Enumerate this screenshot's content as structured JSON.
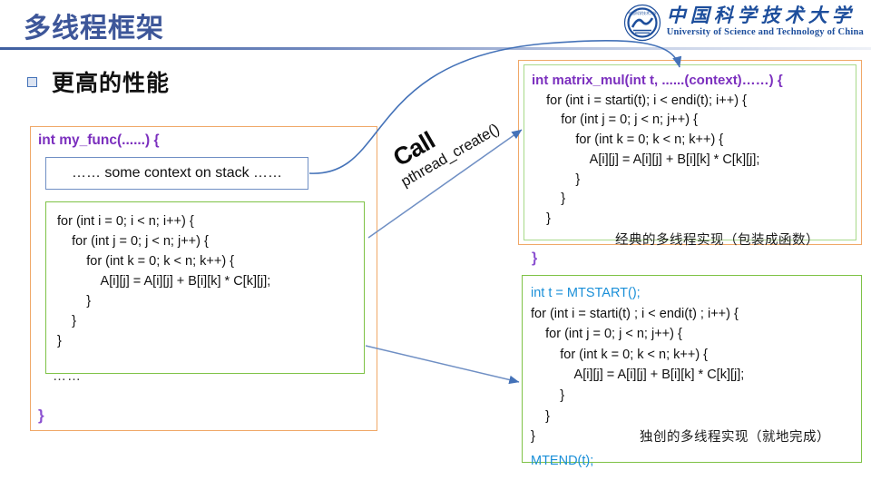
{
  "slide": {
    "title": "多线程框架",
    "bullet": "更高的性能"
  },
  "logo": {
    "cn_name": "中国科学技术大学",
    "en_name": "University of Science and Technology of China",
    "seal_icon": "ustc-seal-icon",
    "accent_color": "#1d4e9c"
  },
  "left_block": {
    "signature": "int my_func(......) {",
    "context_box": "…… some context on stack ……",
    "loop_code": "for (int i = 0; i < n; i++) {\n    for (int j = 0; j < n; j++) {\n        for (int k = 0; k < n; k++) {\n            A[i][j] = A[i][j] + B[i][k] * C[k][j];\n        }\n    }\n}",
    "ellipsis": "……",
    "closing_brace": "}"
  },
  "arrow_label": {
    "primary": "Call",
    "secondary": "pthread_create()"
  },
  "top_right_block": {
    "signature": "int matrix_mul(int t, ......(context)……) {",
    "code": "    for (int i = starti(t); i < endi(t); i++) {\n        for (int j = 0; j < n; j++) {\n            for (int k = 0; k < n; k++) {\n                A[i][j] = A[i][j] + B[i][k] * C[k][j];\n            }\n        }\n    }",
    "caption": "经典的多线程实现（包装成函数）",
    "closing_brace": "}"
  },
  "bottom_right_block": {
    "start_call": "int t = MTSTART();",
    "code": "for (int i = starti(t) ; i < endi(t) ; i++) {\n    for (int j = 0; j < n; j++) {\n        for (int k = 0; k < n; k++) {\n            A[i][j] = A[i][j] + B[i][k] * C[k][j];\n        }\n    }\n}",
    "caption": "独创的多线程实现（就地完成）",
    "end_call": "MTEND(t);"
  },
  "colors": {
    "title_blue": "#3d5699",
    "purple": "#7b2fbe",
    "green_border": "#7ec246",
    "orange_border": "#f0a868",
    "blue_border": "#6f8fc4",
    "mt_blue": "#1a8fd8",
    "arrow_blue": "#4472b8"
  }
}
